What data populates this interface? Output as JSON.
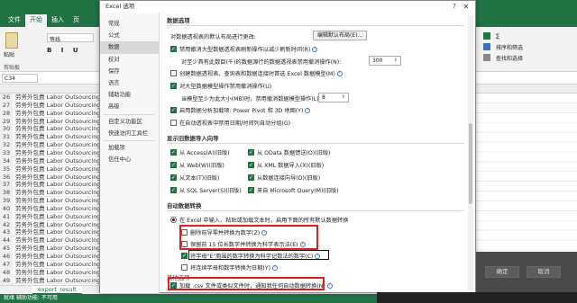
{
  "excel": {
    "ribbon_tabs": [
      "文件",
      "开始",
      "插入",
      "页"
    ],
    "active_tab": "开始",
    "paste_label": "粘贴",
    "clipboard_label": "剪贴板",
    "font_name": "等线",
    "font_format": "B I U",
    "name_box": "C34",
    "sheet_tab": "export_result",
    "status": "就绪 辅助功能: 不可用",
    "ribbon_right": [
      "∑",
      "排序和筛选",
      "查找和选择"
    ],
    "rows": [
      {
        "n": "26",
        "t": "劳务外包费 Labor Outsourcing"
      },
      {
        "n": "27",
        "t": "劳务外包费 Labor Outsourcing"
      },
      {
        "n": "28",
        "t": "劳务外包费 Labor Outsourcing"
      },
      {
        "n": "29",
        "t": "劳务外包费 Labor Outsourcing"
      },
      {
        "n": "30",
        "t": "劳务外包费 Labor Outsourcing"
      },
      {
        "n": "31",
        "t": "劳务外包费 Labor Outsourcing"
      },
      {
        "n": "32",
        "t": "劳务外包费 Labor Outsourcing"
      },
      {
        "n": "33",
        "t": "劳务外包费 Labor Outsourcing"
      },
      {
        "n": "34",
        "t": "劳务外包费 Labor Outsourcing"
      },
      {
        "n": "35",
        "t": "劳务外包费 Labor Outsourcing"
      },
      {
        "n": "36",
        "t": "劳务外包费 Labor Outsourcing"
      },
      {
        "n": "37",
        "t": "劳务外包费 Labor Outsourcing"
      },
      {
        "n": "38",
        "t": "劳务外包费 Labor Outsourcing"
      },
      {
        "n": "39",
        "t": "劳务外包费 Labor Outsourcing"
      },
      {
        "n": "40",
        "t": "劳务外包费 Labor Outsourcing"
      },
      {
        "n": "41",
        "t": "劳务外包费 Labor Outsourcing"
      },
      {
        "n": "42",
        "t": "劳务外包费 Labor Outsourcing"
      },
      {
        "n": "43",
        "t": "劳务外包费 Labor Outsourcing"
      },
      {
        "n": "44",
        "t": "劳务外包费 Labor Outsourcing"
      },
      {
        "n": "45",
        "t": "劳务外包费 Labor Outsourcing"
      },
      {
        "n": "46",
        "t": "劳务外包费 Labor Outsourcing"
      },
      {
        "n": "47",
        "t": "劳务外包费 Labor Outsourcing"
      },
      {
        "n": "48",
        "t": "劳务外包费 Labor Outsourcing"
      },
      {
        "n": "49",
        "t": "劳务外包费 Labor Outsourcing"
      }
    ]
  },
  "dialog": {
    "title": "Excel 选项",
    "help": "?",
    "close": "✕",
    "nav": [
      "常规",
      "公式",
      "数据",
      "校对",
      "保存",
      "语言",
      "辅助功能",
      "高级",
      "自定义功能区",
      "快速访问工具栏",
      "加载项",
      "信任中心"
    ],
    "nav_selected": "数据",
    "sections": {
      "pivot": "数据选项",
      "legacy": "显示旧数据导入向导",
      "autoconvert": "自动数据转换",
      "other": "其他选项"
    },
    "pivot_layout_label": "对数据透视表的默认布局进行更改:",
    "pivot_layout_button": "编辑默认布局(E)...",
    "opt_disable_undo_large": "禁用撤消大型数据透视表刷新操作以减少刷新时间(R)",
    "opt_undo_rows_label": "对至少具有此数目(千)的数据源行的数据透视表禁用撤消操作(N):",
    "opt_undo_rows_value": "300",
    "opt_prefer_model": "创建数据透视表、查询表和数据连接时首选 Excel 数据模型(M)",
    "opt_disable_undo_model": "对大型数据模型操作禁用撤消操作(U)",
    "opt_model_size_label": "当模型至少为此大小(MB)时，禁用撤消数据模型操作(L):",
    "opt_model_size_value": "8",
    "opt_powerpivot": "启用数据分析加载项: Power Pivot 和 3D 地图(Y)",
    "opt_datetime_group": "在自动透视表中禁用日期/时间列自动分组(G)",
    "legacy_left": [
      "从 Access(A)(旧版)",
      "从 Web(W)(旧版)",
      "从文本(T)(旧版)",
      "从 SQL Server(S)(旧版)"
    ],
    "legacy_right": [
      "从 OData 数据馈送(O)(旧版)",
      "从 XML 数据导入(X)(旧版)",
      "从数据连接向导(D)(旧版)",
      "来自 Microsoft Query(M)(旧版)"
    ],
    "auto_radio": "在 Excel 中输入、粘贴或加载文本时，启用下面的所有默认数据转换",
    "auto_leading_zeros": "删除前导零并转换为数字(Z)",
    "auto_15digits": "保留前 15 位长数字并转换为科学表示法(E)",
    "auto_e_letter": "将字母\"E\"周围的数字转换为科学记数法的数字(C)",
    "auto_dates": "将连续字母和数字转换为日期(Y)",
    "auto_csv": "加载 .csv 文件或类似文件时，通知我任何自动数据转换(N)",
    "ok": "确定",
    "cancel": "取消"
  }
}
